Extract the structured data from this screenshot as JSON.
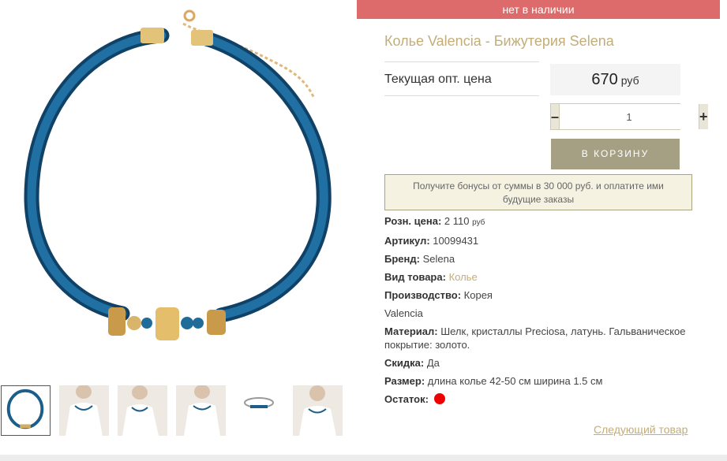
{
  "product": {
    "stock_status": "нет в наличии",
    "title": "Колье Valencia - Бижутерия Selena",
    "price_label": "Текущая опт. цена",
    "price_value": "670",
    "price_currency": "руб",
    "quantity": "1",
    "qty_minus": "–",
    "qty_plus": "+",
    "cart_button": "В КОРЗИНУ",
    "bonus_text": "Получите бонусы от суммы в 30 000 руб. и оплатите ими будущие заказы",
    "next_link": "Следующий товар"
  },
  "specs": {
    "retail_label": "Розн. цена:",
    "retail_value": "2 110",
    "retail_currency": "руб",
    "article_label": "Артикул:",
    "article_value": "10099431",
    "brand_label": "Бренд:",
    "brand_value": "Selena",
    "type_label": "Вид товара:",
    "type_value": "Колье",
    "origin_label": "Производство:",
    "origin_value": "Корея",
    "collection": "Valencia",
    "material_label": "Материал:",
    "material_value": "Шелк, кристаллы Preciosa, латунь. Гальваническое покрытие: золото.",
    "discount_label": "Скидка:",
    "discount_value": "Да",
    "size_label": "Размер:",
    "size_value": "длина колье 42-50 см ширина 1.5 см",
    "stock_label": "Остаток:"
  },
  "colors": {
    "banner": "#dd6b6b",
    "accent_gold": "#c4ad76",
    "cart_button": "#a5a084",
    "necklace_blue": "#1b5e8c",
    "stock_dot": "#ee0000"
  },
  "thumbnails": [
    {
      "icon": "necklace-thumb-icon"
    },
    {
      "icon": "model-thumb-icon"
    },
    {
      "icon": "model-thumb-icon"
    },
    {
      "icon": "model-thumb-icon"
    },
    {
      "icon": "necklace-side-thumb-icon"
    },
    {
      "icon": "model-thumb-icon"
    }
  ]
}
